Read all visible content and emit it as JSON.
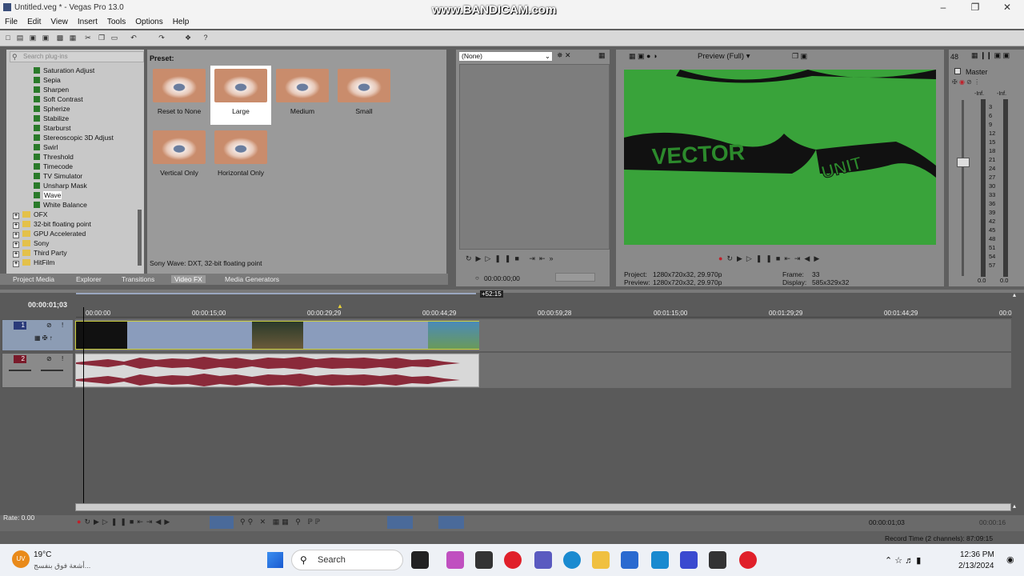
{
  "window": {
    "title": "Untitled.veg * - Vegas Pro 13.0",
    "watermark": "www.BANDICAM.com"
  },
  "menu": [
    "File",
    "Edit",
    "View",
    "Insert",
    "Tools",
    "Options",
    "Help"
  ],
  "fx_panel": {
    "search_placeholder": "Search plug-ins",
    "items": [
      "Saturation Adjust",
      "Sepia",
      "Sharpen",
      "Soft Contrast",
      "Spherize",
      "Stabilize",
      "Starburst",
      "Stereoscopic 3D Adjust",
      "Swirl",
      "Threshold",
      "Timecode",
      "TV Simulator",
      "Unsharp Mask",
      "Wave",
      "White Balance"
    ],
    "selected_item": "Wave",
    "folders": [
      "OFX",
      "32-bit floating point",
      "GPU Accelerated",
      "Sony",
      "Third Party",
      "HitFilm"
    ]
  },
  "preset_panel": {
    "header": "Preset:",
    "presets": [
      "Reset to None",
      "Large",
      "Medium",
      "Small",
      "Vertical Only",
      "Horizontal Only"
    ],
    "selected": "Large",
    "status": "Sony Wave: DXT, 32-bit floating point"
  },
  "tabs": [
    "Project Media",
    "Explorer",
    "Transitions",
    "Video FX",
    "Media Generators"
  ],
  "active_tab": "Video FX",
  "trimmer": {
    "select_value": "(None)",
    "time": "00:00:00;00"
  },
  "preview": {
    "label": "Preview (Full)",
    "project_label": "Project:",
    "project_value": "1280x720x32, 29.970p",
    "preview_label": "Preview:",
    "preview_value": "1280x720x32, 29.970p",
    "frame_label": "Frame:",
    "frame_value": "33",
    "display_label": "Display:",
    "display_value": "585x329x32",
    "video_text_left": "VECTOR",
    "video_text_right": "UNIT"
  },
  "master": {
    "label": "Master",
    "level_top": "48",
    "left_inf": "-Inf.",
    "right_inf": "-Inf.",
    "scale": [
      "3",
      "6",
      "9",
      "12",
      "15",
      "18",
      "21",
      "24",
      "27",
      "30",
      "33",
      "36",
      "39",
      "42",
      "45",
      "48",
      "51",
      "54",
      "57"
    ],
    "bottom_left": "0.0",
    "bottom_right": "0.0"
  },
  "timeline": {
    "current_time": "00:00:01;03",
    "marker": "+52:15",
    "ruler": [
      "00:00:00",
      "00:00:15;00",
      "00:00:29;29",
      "00:00:44;29",
      "00:00:59;28",
      "00:01:15;00",
      "00:01:29;29",
      "00:01:44;29",
      "00:0"
    ],
    "track1_number": "1",
    "track2_number": "2",
    "rate": "Rate: 0.00",
    "end_time": "00:00:01;03",
    "end_time2": "00:00:16",
    "record_time": "Record Time (2 channels): 87:09:15"
  },
  "taskbar": {
    "weather_temp": "19°C",
    "weather_text": "أشعة فوق بنفسج...",
    "weather_badge": "UV",
    "search": "Search",
    "time": "12:36 PM",
    "date": "2/13/2024"
  }
}
